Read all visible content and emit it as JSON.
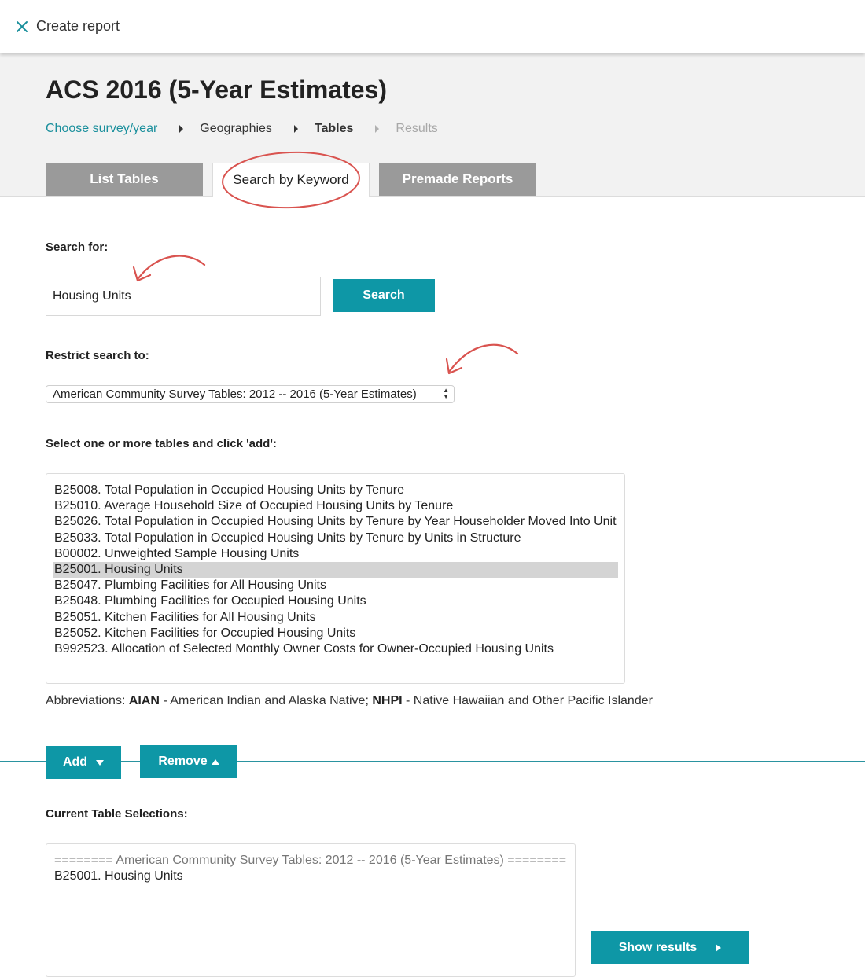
{
  "topbar": {
    "title": "Create report",
    "close_icon": "close-icon"
  },
  "header": {
    "title": "ACS 2016 (5-Year Estimates)",
    "breadcrumbs": [
      {
        "label": "Choose survey/year",
        "state": "link"
      },
      {
        "label": "Geographies",
        "state": "done"
      },
      {
        "label": "Tables",
        "state": "current"
      },
      {
        "label": "Results",
        "state": "disabled"
      }
    ]
  },
  "tabs": [
    {
      "label": "List Tables",
      "active": false
    },
    {
      "label": "Search by Keyword",
      "active": true
    },
    {
      "label": "Premade Reports",
      "active": false
    }
  ],
  "search": {
    "label": "Search for:",
    "value": "Housing Units",
    "button": "Search"
  },
  "restrict": {
    "label": "Restrict search to:",
    "selected": "American Community Survey Tables: 2012 -- 2016 (5-Year Estimates)"
  },
  "tables": {
    "label": "Select one or more tables and click 'add':",
    "items": [
      "B25008. Total Population in Occupied Housing Units by Tenure",
      "B25010. Average Household Size of Occupied Housing Units by Tenure",
      "B25026. Total Population in Occupied Housing Units by Tenure by Year Householder Moved Into Unit",
      "B25033. Total Population in Occupied Housing Units by Tenure by Units in Structure",
      "B00002. Unweighted Sample Housing Units",
      "B25001. Housing Units",
      "B25047. Plumbing Facilities for All Housing Units",
      "B25048. Plumbing Facilities for Occupied Housing Units",
      "B25051. Kitchen Facilities for All Housing Units",
      "B25052. Kitchen Facilities for Occupied Housing Units",
      "B992523. Allocation of Selected Monthly Owner Costs for Owner-Occupied Housing Units"
    ],
    "selected_index": 5
  },
  "abbreviations": {
    "prefix": "Abbreviations:",
    "aian_code": "AIAN",
    "aian_text": "- American Indian and Alaska Native;",
    "nhpi_code": "NHPI",
    "nhpi_text": "- Native Hawaiian and Other Pacific Islander"
  },
  "actions": {
    "add": "Add",
    "remove": "Remove"
  },
  "current": {
    "label": "Current Table Selections:",
    "section": "======== American Community Survey Tables: 2012 -- 2016 (5-Year Estimates) ========",
    "items": [
      "B25001. Housing Units"
    ]
  },
  "show_results": "Show results",
  "colors": {
    "accent": "#0e97a6",
    "link": "#1a8f9c",
    "annotation": "#d9534f",
    "tab_inactive": "#9a9a9a",
    "selection": "#d4d4d4"
  }
}
